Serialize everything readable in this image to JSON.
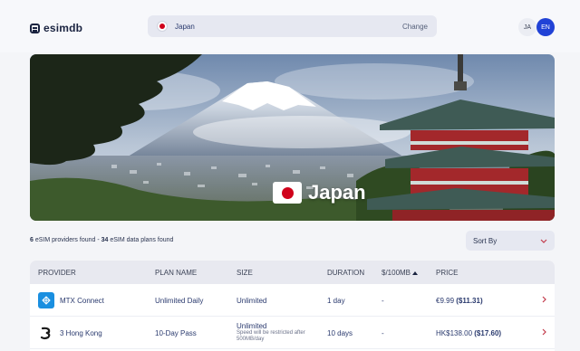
{
  "header": {
    "logo_text": "esimdb",
    "country_name": "Japan",
    "change_label": "Change",
    "lang_ja": "JA",
    "lang_en": "EN"
  },
  "hero": {
    "title": "Japan"
  },
  "summary": {
    "providers_count": "6",
    "providers_label": " eSIM providers found - ",
    "plans_count": "34",
    "plans_label": " eSIM data plans found"
  },
  "sort": {
    "label": "Sort By"
  },
  "table": {
    "headers": {
      "provider": "PROVIDER",
      "plan": "PLAN NAME",
      "size": "SIZE",
      "duration": "DURATION",
      "per100": "$/100MB",
      "price": "PRICE"
    },
    "rows": [
      {
        "provider": "MTX Connect",
        "plan": "Unlimited Daily",
        "size": "Unlimited",
        "size_note": "",
        "duration": "1 day",
        "per100": "-",
        "price": "€9.99",
        "price_usd": "($11.31)"
      },
      {
        "provider": "3 Hong Kong",
        "plan": "10-Day Pass",
        "size": "Unlimited",
        "size_note": "Speed will be restricted after 500MB/day",
        "duration": "10 days",
        "per100": "-",
        "price": "HK$138.00",
        "price_usd": "($17.60)"
      }
    ]
  },
  "colors": {
    "accent": "#2142d6",
    "chevron": "#c23a4b",
    "text": "#1a2340"
  },
  "icons": [
    "esimdb-logo-icon",
    "japan-flag-icon",
    "chevron-down-icon",
    "chevron-right-icon",
    "sort-asc-icon",
    "mtx-connect-logo-icon",
    "three-logo-icon"
  ]
}
